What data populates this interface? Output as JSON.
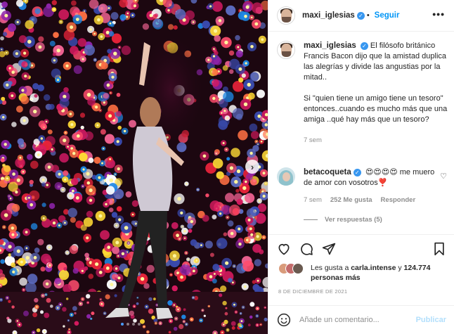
{
  "author": {
    "username": "maxi_iglesias",
    "follow_label": "Seguir",
    "more_label": "•••"
  },
  "caption": {
    "username": "maxi_iglesias",
    "text": "El filósofo británico Francis Bacon dijo que la amistad duplica las alegrías y divide las angustias por la mitad..\n\nSi \"quien tiene un amigo tiene un tesoro\" entonces..cuando es mucho más que una amiga ..qué hay más que un tesoro?",
    "time": "7 sem"
  },
  "comment": {
    "username": "betacoqueta",
    "text": "😍😍😍😍 me muero de amor con vosotros❣️",
    "time": "7 sem",
    "likes": "252 Me gusta",
    "reply_label": "Responder",
    "view_replies": "Ver respuestas (5)"
  },
  "likes": {
    "prefix": "Les gusta a",
    "user": "carla.intense",
    "conj": "y",
    "others": "124.774 personas más"
  },
  "date": "8 DE DICIEMBRE DE 2021",
  "comment_input": {
    "placeholder": "Añade un comentario...",
    "publish_label": "Publicar"
  },
  "carousel": {
    "slide_count": 4,
    "active_index": 0,
    "next_glyph": "›"
  },
  "colors": {
    "accent": "#0095f6",
    "verified": "#3897f0",
    "muted": "#8e8e8e",
    "publish_disabled": "#b2dffc"
  },
  "icons": {
    "like": "heart-icon",
    "comment": "comment-icon",
    "share": "share-icon",
    "save": "bookmark-icon",
    "emoji": "emoji-icon",
    "verified": "verified-badge-icon",
    "comment_like": "small-heart-icon"
  }
}
